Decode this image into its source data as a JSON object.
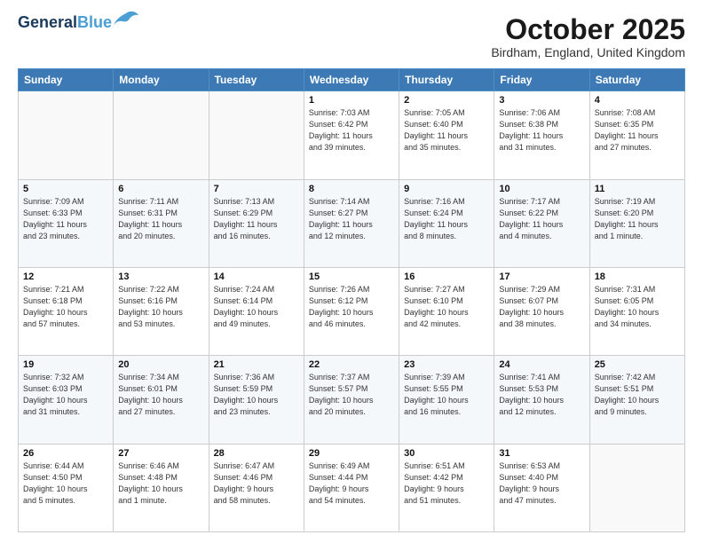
{
  "header": {
    "logo_line1": "General",
    "logo_line2": "Blue",
    "month": "October 2025",
    "location": "Birdham, England, United Kingdom"
  },
  "days_of_week": [
    "Sunday",
    "Monday",
    "Tuesday",
    "Wednesday",
    "Thursday",
    "Friday",
    "Saturday"
  ],
  "weeks": [
    [
      {
        "num": "",
        "info": ""
      },
      {
        "num": "",
        "info": ""
      },
      {
        "num": "",
        "info": ""
      },
      {
        "num": "1",
        "info": "Sunrise: 7:03 AM\nSunset: 6:42 PM\nDaylight: 11 hours\nand 39 minutes."
      },
      {
        "num": "2",
        "info": "Sunrise: 7:05 AM\nSunset: 6:40 PM\nDaylight: 11 hours\nand 35 minutes."
      },
      {
        "num": "3",
        "info": "Sunrise: 7:06 AM\nSunset: 6:38 PM\nDaylight: 11 hours\nand 31 minutes."
      },
      {
        "num": "4",
        "info": "Sunrise: 7:08 AM\nSunset: 6:35 PM\nDaylight: 11 hours\nand 27 minutes."
      }
    ],
    [
      {
        "num": "5",
        "info": "Sunrise: 7:09 AM\nSunset: 6:33 PM\nDaylight: 11 hours\nand 23 minutes."
      },
      {
        "num": "6",
        "info": "Sunrise: 7:11 AM\nSunset: 6:31 PM\nDaylight: 11 hours\nand 20 minutes."
      },
      {
        "num": "7",
        "info": "Sunrise: 7:13 AM\nSunset: 6:29 PM\nDaylight: 11 hours\nand 16 minutes."
      },
      {
        "num": "8",
        "info": "Sunrise: 7:14 AM\nSunset: 6:27 PM\nDaylight: 11 hours\nand 12 minutes."
      },
      {
        "num": "9",
        "info": "Sunrise: 7:16 AM\nSunset: 6:24 PM\nDaylight: 11 hours\nand 8 minutes."
      },
      {
        "num": "10",
        "info": "Sunrise: 7:17 AM\nSunset: 6:22 PM\nDaylight: 11 hours\nand 4 minutes."
      },
      {
        "num": "11",
        "info": "Sunrise: 7:19 AM\nSunset: 6:20 PM\nDaylight: 11 hours\nand 1 minute."
      }
    ],
    [
      {
        "num": "12",
        "info": "Sunrise: 7:21 AM\nSunset: 6:18 PM\nDaylight: 10 hours\nand 57 minutes."
      },
      {
        "num": "13",
        "info": "Sunrise: 7:22 AM\nSunset: 6:16 PM\nDaylight: 10 hours\nand 53 minutes."
      },
      {
        "num": "14",
        "info": "Sunrise: 7:24 AM\nSunset: 6:14 PM\nDaylight: 10 hours\nand 49 minutes."
      },
      {
        "num": "15",
        "info": "Sunrise: 7:26 AM\nSunset: 6:12 PM\nDaylight: 10 hours\nand 46 minutes."
      },
      {
        "num": "16",
        "info": "Sunrise: 7:27 AM\nSunset: 6:10 PM\nDaylight: 10 hours\nand 42 minutes."
      },
      {
        "num": "17",
        "info": "Sunrise: 7:29 AM\nSunset: 6:07 PM\nDaylight: 10 hours\nand 38 minutes."
      },
      {
        "num": "18",
        "info": "Sunrise: 7:31 AM\nSunset: 6:05 PM\nDaylight: 10 hours\nand 34 minutes."
      }
    ],
    [
      {
        "num": "19",
        "info": "Sunrise: 7:32 AM\nSunset: 6:03 PM\nDaylight: 10 hours\nand 31 minutes."
      },
      {
        "num": "20",
        "info": "Sunrise: 7:34 AM\nSunset: 6:01 PM\nDaylight: 10 hours\nand 27 minutes."
      },
      {
        "num": "21",
        "info": "Sunrise: 7:36 AM\nSunset: 5:59 PM\nDaylight: 10 hours\nand 23 minutes."
      },
      {
        "num": "22",
        "info": "Sunrise: 7:37 AM\nSunset: 5:57 PM\nDaylight: 10 hours\nand 20 minutes."
      },
      {
        "num": "23",
        "info": "Sunrise: 7:39 AM\nSunset: 5:55 PM\nDaylight: 10 hours\nand 16 minutes."
      },
      {
        "num": "24",
        "info": "Sunrise: 7:41 AM\nSunset: 5:53 PM\nDaylight: 10 hours\nand 12 minutes."
      },
      {
        "num": "25",
        "info": "Sunrise: 7:42 AM\nSunset: 5:51 PM\nDaylight: 10 hours\nand 9 minutes."
      }
    ],
    [
      {
        "num": "26",
        "info": "Sunrise: 6:44 AM\nSunset: 4:50 PM\nDaylight: 10 hours\nand 5 minutes."
      },
      {
        "num": "27",
        "info": "Sunrise: 6:46 AM\nSunset: 4:48 PM\nDaylight: 10 hours\nand 1 minute."
      },
      {
        "num": "28",
        "info": "Sunrise: 6:47 AM\nSunset: 4:46 PM\nDaylight: 9 hours\nand 58 minutes."
      },
      {
        "num": "29",
        "info": "Sunrise: 6:49 AM\nSunset: 4:44 PM\nDaylight: 9 hours\nand 54 minutes."
      },
      {
        "num": "30",
        "info": "Sunrise: 6:51 AM\nSunset: 4:42 PM\nDaylight: 9 hours\nand 51 minutes."
      },
      {
        "num": "31",
        "info": "Sunrise: 6:53 AM\nSunset: 4:40 PM\nDaylight: 9 hours\nand 47 minutes."
      },
      {
        "num": "",
        "info": ""
      }
    ]
  ]
}
